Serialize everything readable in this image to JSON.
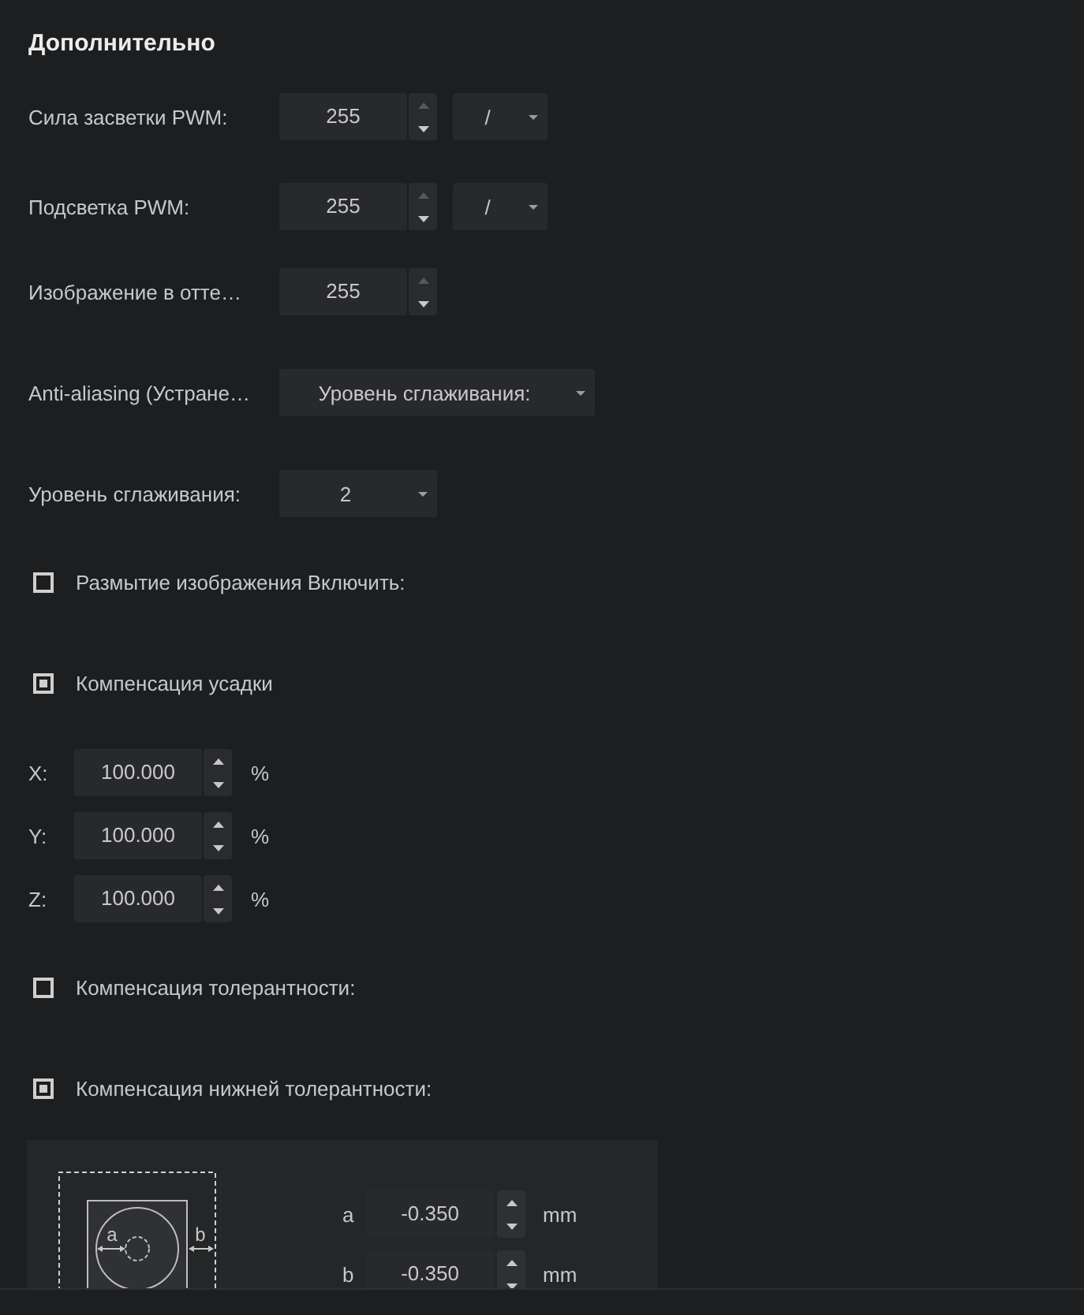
{
  "section": {
    "title": "Дополнительно"
  },
  "rows": [
    {
      "kind": "spin_select",
      "label": "Сила засветки PWM:",
      "spin": {
        "value": "255",
        "up_disabled": true
      },
      "select": {
        "value": "/"
      }
    },
    {
      "kind": "spin_select",
      "label": "Подсветка PWM:",
      "spin": {
        "value": "255",
        "up_disabled": true
      },
      "select": {
        "value": "/"
      }
    },
    {
      "kind": "spin",
      "label": "Изображение в отте…",
      "spin": {
        "value": "255",
        "up_disabled": true
      }
    },
    {
      "kind": "select_wide",
      "label": "Anti-aliasing (Устране…",
      "select": {
        "value": "Уровень сглаживания:"
      }
    },
    {
      "kind": "select",
      "label": "Уровень сглаживания:",
      "select": {
        "value": "2"
      }
    },
    {
      "kind": "checkbox",
      "label": "Размытие изображения Включить:",
      "checked": false
    },
    {
      "kind": "checkbox",
      "label": "Компенсация усадки",
      "checked": true
    },
    {
      "kind": "axis",
      "label": "X:",
      "spin": {
        "value": "100.000",
        "up_disabled": false
      },
      "unit": "%"
    },
    {
      "kind": "axis",
      "label": "Y:",
      "spin": {
        "value": "100.000",
        "up_disabled": false
      },
      "unit": "%"
    },
    {
      "kind": "axis",
      "label": "Z:",
      "spin": {
        "value": "100.000",
        "up_disabled": false
      },
      "unit": "%"
    },
    {
      "kind": "checkbox",
      "label": "Компенсация толерантности:",
      "checked": false
    },
    {
      "kind": "checkbox",
      "label": "Компенсация нижней толерантности:",
      "checked": true
    },
    {
      "kind": "panel",
      "diagram_labels": [
        "a",
        "b"
      ],
      "fields": [
        {
          "label": "a",
          "spin": {
            "value": "-0.350",
            "up_disabled": false
          },
          "unit": "mm"
        },
        {
          "label": "b",
          "spin": {
            "value": "-0.350",
            "up_disabled": false
          },
          "unit": "mm"
        }
      ]
    }
  ]
}
